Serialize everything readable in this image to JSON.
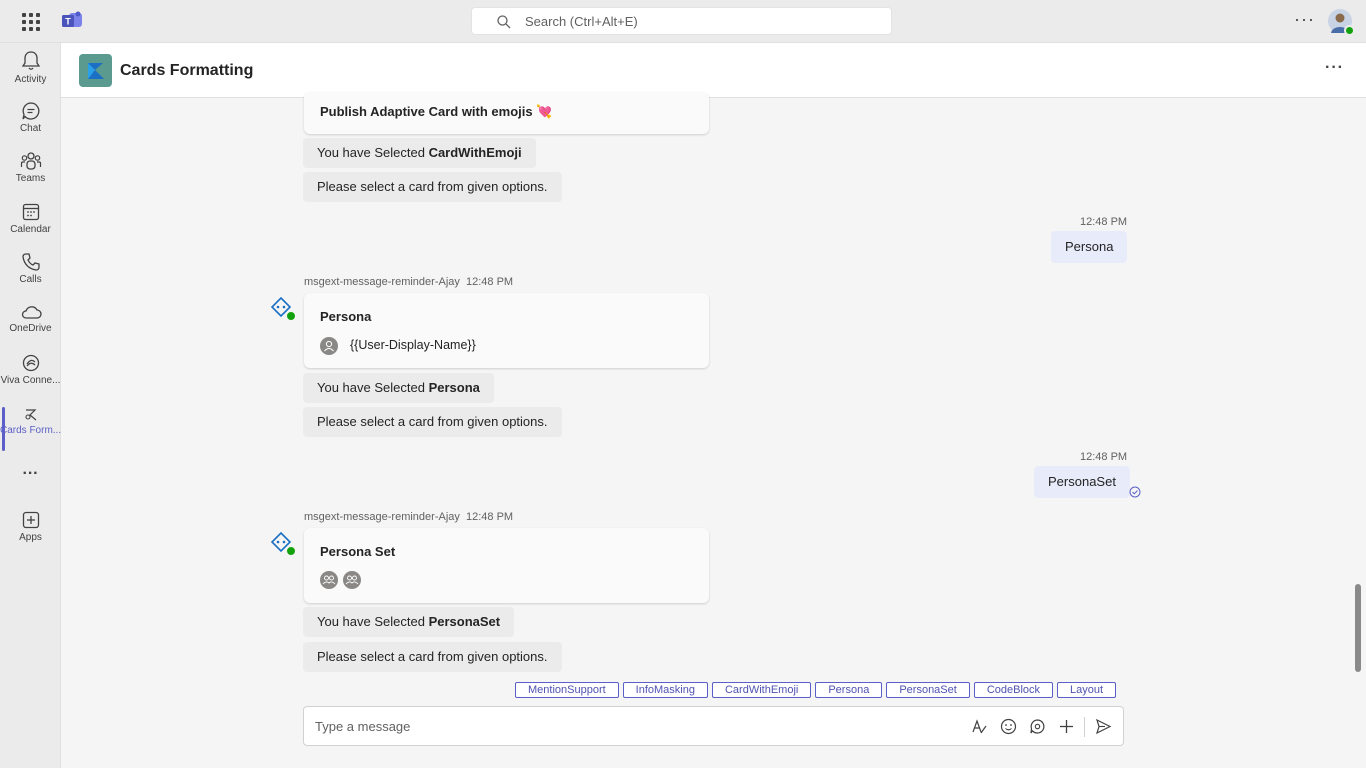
{
  "topbar": {
    "search_placeholder": "Search (Ctrl+Alt+E)",
    "more_label": "···"
  },
  "rail": {
    "items": [
      {
        "label": "Activity",
        "icon": "bell-icon"
      },
      {
        "label": "Chat",
        "icon": "chat-icon"
      },
      {
        "label": "Teams",
        "icon": "teams-icon"
      },
      {
        "label": "Calendar",
        "icon": "calendar-icon"
      },
      {
        "label": "Calls",
        "icon": "phone-icon"
      },
      {
        "label": "OneDrive",
        "icon": "cloud-icon"
      },
      {
        "label": "Viva Conne...",
        "icon": "viva-connections-icon"
      },
      {
        "label": "Cards Form...",
        "icon": "cards-formatting-app-icon",
        "active": true
      },
      {
        "label": "···",
        "icon": "more-apps-icon"
      },
      {
        "label": "Apps",
        "icon": "add-apps-icon"
      }
    ]
  },
  "header": {
    "title": "Cards Formatting",
    "more_label": "···"
  },
  "messages": {
    "card1_title": "Publish Adaptive Card with emojis 💘",
    "selected1_prefix": "You have Selected ",
    "selected1_value": "CardWithEmoji",
    "prompt": "Please select a card from given options.",
    "out1_time": "12:48 PM",
    "out1_text": "Persona",
    "bot_name": "msgext-message-reminder-Ajay",
    "bot1_time": "12:48 PM",
    "card2_title": "Persona",
    "card2_user": "{{User-Display-Name}}",
    "selected2_prefix": "You have Selected ",
    "selected2_value": "Persona",
    "out2_time": "12:48 PM",
    "out2_text": "PersonaSet",
    "bot2_time": "12:48 PM",
    "card3_title": "Persona Set",
    "selected3_prefix": "You have Selected ",
    "selected3_value": "PersonaSet"
  },
  "suggestions": [
    "MentionSupport",
    "InfoMasking",
    "CardWithEmoji",
    "Persona",
    "PersonaSet",
    "CodeBlock",
    "Layout"
  ],
  "compose": {
    "placeholder": "Type a message",
    "tools": [
      "format-icon",
      "emoji-icon",
      "loop-icon",
      "attach-plus-icon",
      "send-icon"
    ]
  },
  "colors": {
    "accent": "#5b5fc7",
    "outgoing_bubble": "#e8ebfa",
    "status_available": "#13a10e"
  }
}
